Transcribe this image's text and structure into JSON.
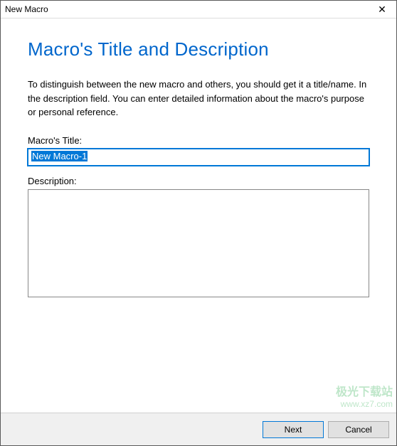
{
  "titlebar": {
    "title": "New Macro",
    "close": "✕"
  },
  "heading": "Macro's Title and Description",
  "instruction": "To distinguish between the new macro and others, you should get it a title/name. In the description field. You can enter detailed information about the macro's purpose or personal reference.",
  "fields": {
    "titleLabel": "Macro's Title:",
    "titleValue": "New Macro-1",
    "descLabel": "Description:",
    "descValue": ""
  },
  "buttons": {
    "next": "Next",
    "cancel": "Cancel"
  },
  "watermark": {
    "line1": "极光下载站",
    "line2": "www.xz7.com"
  }
}
